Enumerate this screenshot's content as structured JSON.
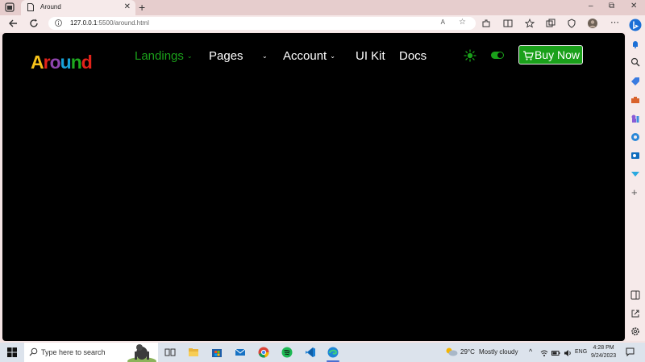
{
  "browser": {
    "tab_title": "Around",
    "url_host": "127.0.0.1",
    "url_path": ":5500/around.html",
    "read_aloud": "A",
    "new_tab": "+",
    "window_controls": [
      "–",
      "⧉",
      "✕"
    ],
    "tab_close": "✕"
  },
  "page": {
    "logo_letters": [
      "A",
      "r",
      "o",
      "u",
      "n",
      "d"
    ],
    "logo_colors": [
      "#f6c21a",
      "#e2231a",
      "#8e44ad",
      "#17a2d8",
      "#1faa1f",
      "#e2231a"
    ],
    "nav": {
      "landings": "Landings",
      "pages": "Pages",
      "account": "Account",
      "ui_kit": "UI Kit",
      "docs": "Docs",
      "caret": "⌄"
    },
    "buy_button": "Buy Now",
    "accent_color": "#1aa01a",
    "theme_toggle_on": true
  },
  "taskbar": {
    "search_placeholder": "Type here to search",
    "weather_temp": "29°C",
    "weather_condition": "Mostly cloudy",
    "language": "ENG",
    "time": "4:28 PM",
    "date": "9/24/2023",
    "tray_caret": "^"
  }
}
